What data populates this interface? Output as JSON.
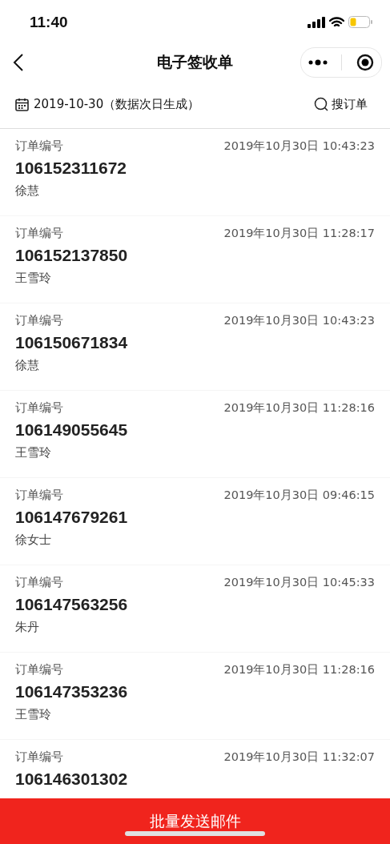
{
  "status_bar": {
    "time": "11:40"
  },
  "nav": {
    "title": "电子签收单"
  },
  "filter": {
    "date": "2019-10-30（数据次日生成）",
    "search": "搜订单"
  },
  "orders": [
    {
      "label": "订单编号",
      "time": "2019年10月30日 10:43:23",
      "number": "106152311672",
      "name": "徐慧"
    },
    {
      "label": "订单编号",
      "time": "2019年10月30日 11:28:17",
      "number": "106152137850",
      "name": "王雪玲"
    },
    {
      "label": "订单编号",
      "time": "2019年10月30日 10:43:23",
      "number": "106150671834",
      "name": "徐慧"
    },
    {
      "label": "订单编号",
      "time": "2019年10月30日 11:28:16",
      "number": "106149055645",
      "name": "王雪玲"
    },
    {
      "label": "订单编号",
      "time": "2019年10月30日 09:46:15",
      "number": "106147679261",
      "name": "徐女士"
    },
    {
      "label": "订单编号",
      "time": "2019年10月30日 10:45:33",
      "number": "106147563256",
      "name": "朱丹"
    },
    {
      "label": "订单编号",
      "time": "2019年10月30日 11:28:16",
      "number": "106147353236",
      "name": "王雪玲"
    },
    {
      "label": "订单编号",
      "time": "2019年10月30日 11:32:07",
      "number": "106146301302"
    }
  ],
  "bottom_button": "批量发送邮件"
}
